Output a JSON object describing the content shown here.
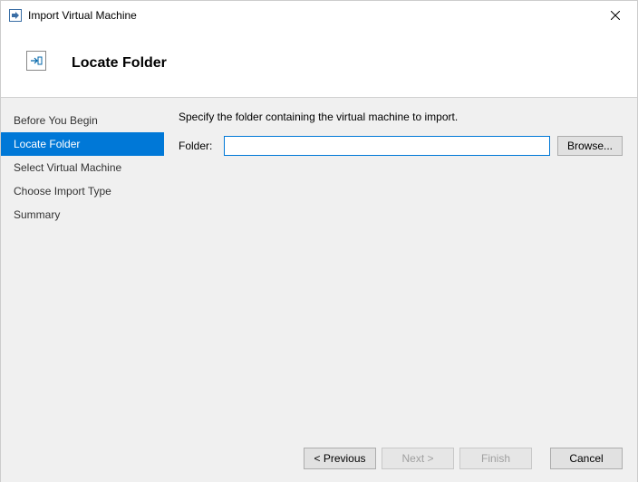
{
  "window": {
    "title": "Import Virtual Machine"
  },
  "header": {
    "page_title": "Locate Folder"
  },
  "sidebar": {
    "items": [
      {
        "label": "Before You Begin",
        "active": false
      },
      {
        "label": "Locate Folder",
        "active": true
      },
      {
        "label": "Select Virtual Machine",
        "active": false
      },
      {
        "label": "Choose Import Type",
        "active": false
      },
      {
        "label": "Summary",
        "active": false
      }
    ]
  },
  "main": {
    "instruction": "Specify the folder containing the virtual machine to import.",
    "folder_label": "Folder:",
    "folder_value": "",
    "browse_label": "Browse..."
  },
  "footer": {
    "previous_label": "< Previous",
    "next_label": "Next >",
    "finish_label": "Finish",
    "cancel_label": "Cancel"
  }
}
